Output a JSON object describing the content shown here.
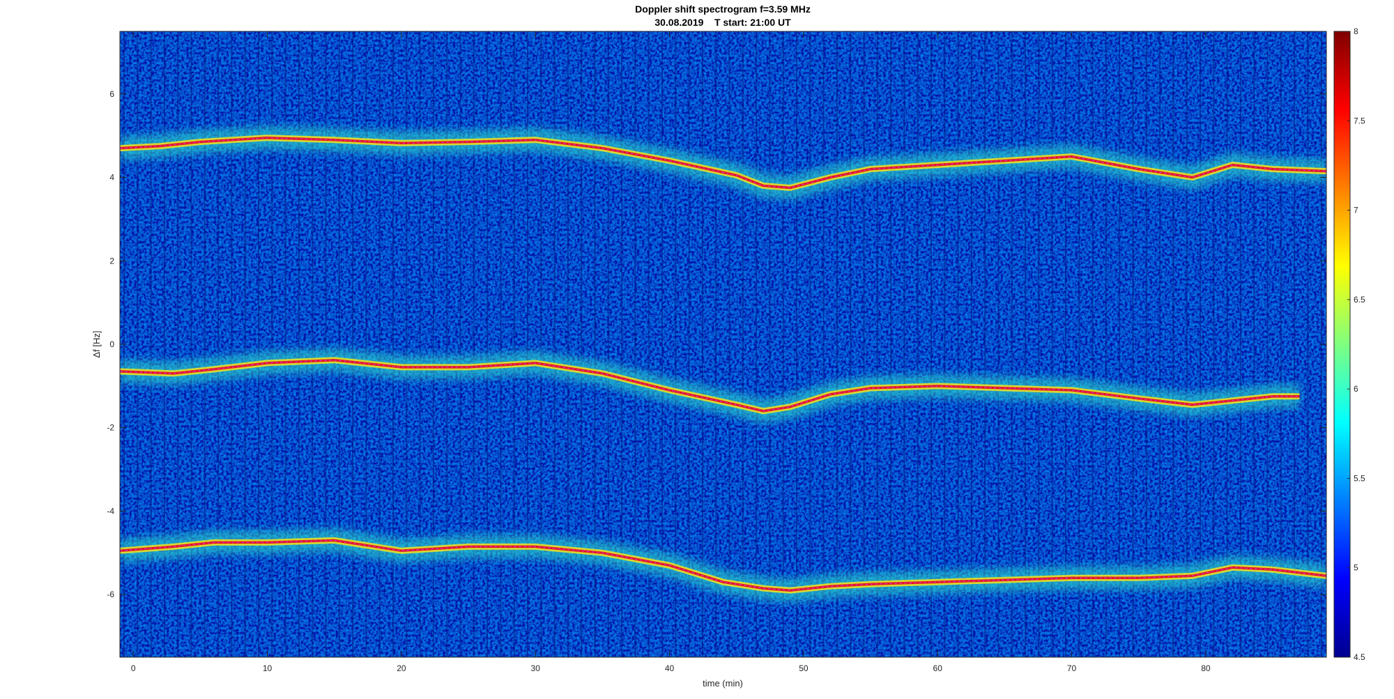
{
  "chart_data": {
    "type": "heatmap",
    "title": "Doppler shift spectrogram f=3.59 MHz",
    "subtitle": "30.08.2019    T start: 21:00 UT",
    "xlabel": "time (min)",
    "ylabel": "Δf [Hz]",
    "xlim": [
      -1,
      89
    ],
    "ylim": [
      -7.5,
      7.5
    ],
    "x_ticks": [
      0,
      10,
      20,
      30,
      40,
      50,
      60,
      70,
      80
    ],
    "y_ticks": [
      -6,
      -4,
      -2,
      0,
      2,
      4,
      6
    ],
    "colorbar": {
      "colormap": "jet",
      "range": [
        4.5,
        8
      ],
      "ticks": [
        4.5,
        5,
        5.5,
        6,
        6.5,
        7,
        7.5,
        8
      ]
    },
    "series": [
      {
        "x": [
          -1,
          2,
          5,
          10,
          15,
          20,
          25,
          30,
          35,
          40,
          45,
          47,
          49,
          52,
          55,
          60,
          65,
          70,
          75,
          79,
          82,
          85,
          89
        ],
        "y": [
          4.7,
          4.75,
          4.85,
          4.95,
          4.9,
          4.82,
          4.85,
          4.9,
          4.7,
          4.4,
          4.05,
          3.8,
          3.75,
          4.0,
          4.2,
          4.3,
          4.4,
          4.5,
          4.2,
          4.0,
          4.3,
          4.2,
          4.15
        ]
      },
      {
        "x": [
          -1,
          3,
          6,
          10,
          15,
          20,
          25,
          30,
          35,
          40,
          45,
          47,
          49,
          52,
          55,
          60,
          65,
          70,
          75,
          79,
          82,
          85,
          87
        ],
        "y": [
          -0.65,
          -0.7,
          -0.6,
          -0.45,
          -0.38,
          -0.55,
          -0.55,
          -0.45,
          -0.7,
          -1.1,
          -1.45,
          -1.6,
          -1.5,
          -1.2,
          -1.05,
          -1.0,
          -1.05,
          -1.1,
          -1.3,
          -1.45,
          -1.35,
          -1.25,
          -1.25
        ]
      },
      {
        "x": [
          -1,
          3,
          6,
          10,
          15,
          20,
          25,
          30,
          35,
          40,
          44,
          47,
          49,
          52,
          55,
          60,
          65,
          70,
          75,
          79,
          82,
          85,
          89
        ],
        "y": [
          -4.95,
          -4.85,
          -4.75,
          -4.75,
          -4.7,
          -4.95,
          -4.85,
          -4.85,
          -5.0,
          -5.3,
          -5.7,
          -5.85,
          -5.9,
          -5.8,
          -5.75,
          -5.7,
          -5.65,
          -5.6,
          -5.6,
          -5.55,
          -5.35,
          -5.4,
          -5.55
        ]
      }
    ]
  }
}
